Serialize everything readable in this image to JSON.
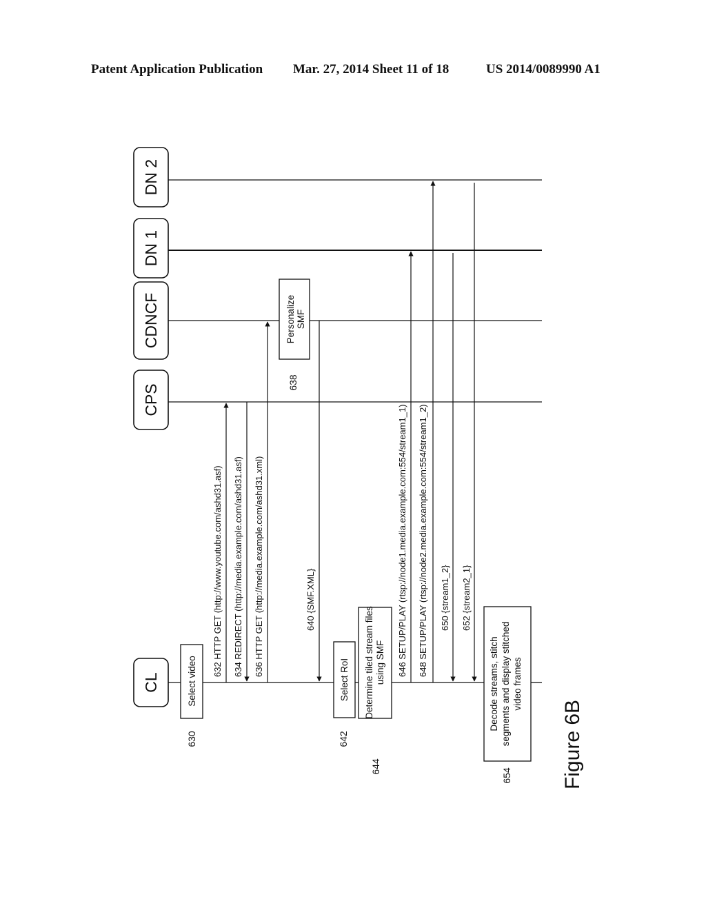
{
  "header": {
    "publication": "Patent Application Publication",
    "date_sheet": "Mar. 27, 2014  Sheet 11 of 18",
    "patent_number": "US 2014/0089990 A1"
  },
  "figure_label": "Figure 6B",
  "participants": [
    {
      "id": "CL",
      "label": "CL"
    },
    {
      "id": "CPS",
      "label": "CPS"
    },
    {
      "id": "CDNCF",
      "label": "CDNCF"
    },
    {
      "id": "DN1",
      "label": "DN 1"
    },
    {
      "id": "DN2",
      "label": "DN 2"
    }
  ],
  "activities": [
    {
      "ref": "630",
      "participant": "CL",
      "text": [
        "Select video"
      ]
    },
    {
      "ref": "638",
      "participant": "CDNCF",
      "text": [
        "Personalize",
        "SMF"
      ]
    },
    {
      "ref": "642",
      "participant": "CL",
      "text": [
        "Select RoI"
      ]
    },
    {
      "ref": "644",
      "participant": "CL",
      "text": [
        "Determine tiled stream files",
        "using SMF"
      ]
    },
    {
      "ref": "654",
      "participant": "CL",
      "text": [
        "Decode streams, stitch",
        "segments and display stitched",
        "video frames"
      ]
    }
  ],
  "messages": [
    {
      "ref": "632",
      "from": "CL",
      "to": "CPS",
      "label": "632 HTTP GET (http://www.youtube.com/ashd31.asf)"
    },
    {
      "ref": "634",
      "from": "CPS",
      "to": "CL",
      "label": "634 REDIRECT (http://media.example.com/ashd31.asf)"
    },
    {
      "ref": "636",
      "from": "CL",
      "to": "CDNCF",
      "label": "636 HTTP GET (http://media.example.com/ashd31.xml)"
    },
    {
      "ref": "640",
      "from": "CDNCF",
      "to": "CL",
      "label": "640 {SMF.XML}"
    },
    {
      "ref": "646",
      "from": "CL",
      "to": "DN1",
      "label": "646 SETUP/PLAY (rtsp://node1.media.example.com:554/stream1_1)"
    },
    {
      "ref": "648",
      "from": "CL",
      "to": "DN2",
      "label": "648 SETUP/PLAY (rtsp://node2.media.example.com:554/stream1_2)"
    },
    {
      "ref": "650",
      "from": "DN1",
      "to": "CL",
      "label": "650 {stream1_2}"
    },
    {
      "ref": "652",
      "from": "DN2",
      "to": "CL",
      "label": "652 {stream2_1}"
    }
  ]
}
